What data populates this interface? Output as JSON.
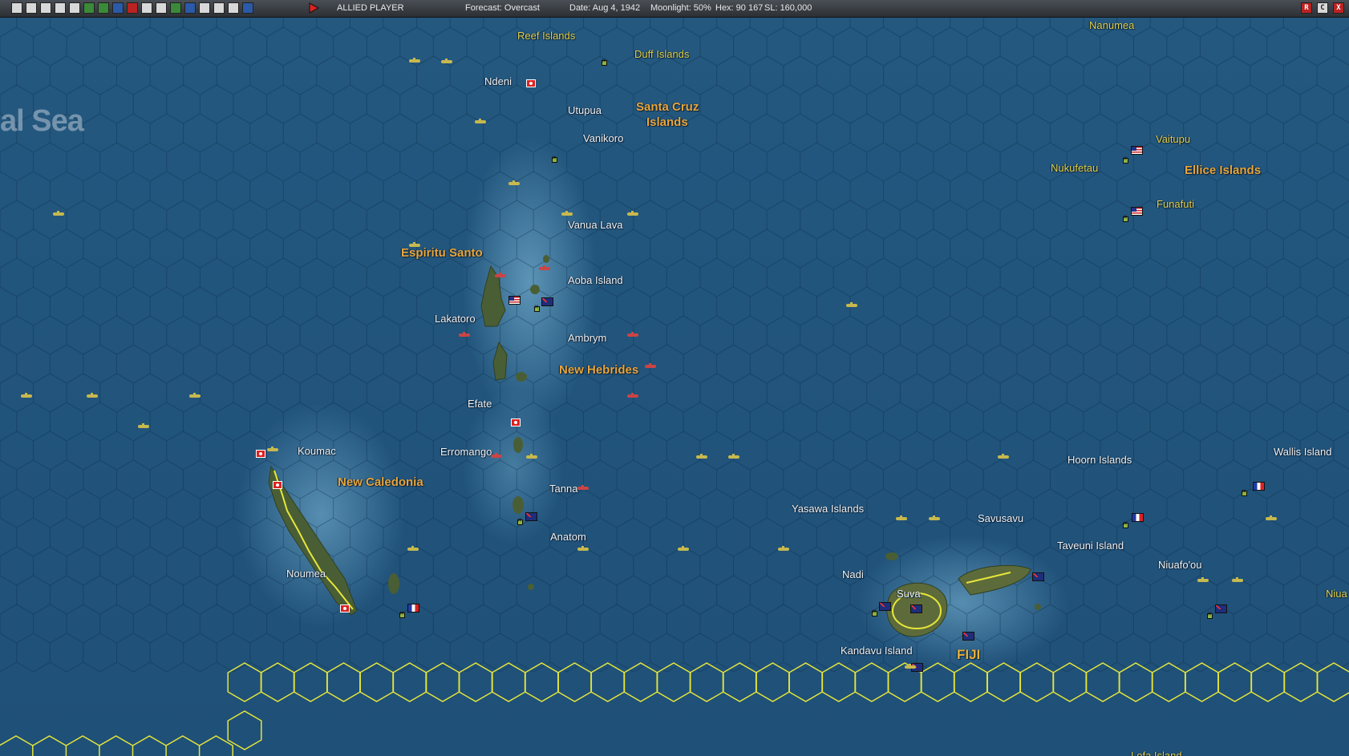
{
  "toolbar": {
    "player": "ALLIED PLAYER",
    "forecast": "Forecast: Overcast",
    "date": "Date: Aug 4, 1942",
    "moonlight": "Moonlight: 50%",
    "hex": "Hex: 90 167",
    "sl": "SL: 160,000",
    "window_buttons": [
      "R",
      "C",
      "X"
    ]
  },
  "map": {
    "sea_label": "al Sea",
    "places": {
      "reef_islands": "Reef Islands",
      "duff_islands": "Duff Islands",
      "nanumea": "Nanumea",
      "ndeni": "Ndeni",
      "utupua": "Utupua",
      "santa_cruz_1": "Santa Cruz",
      "santa_cruz_2": "Islands",
      "vanikoro": "Vanikoro",
      "vaitupu": "Vaitupu",
      "nukufetau": "Nukufetau",
      "ellice_islands": "Ellice Islands",
      "funafuti": "Funafuti",
      "vanua_lava": "Vanua Lava",
      "espiritu_santo": "Espiritu Santo",
      "aoba_island": "Aoba Island",
      "lakatoro": "Lakatoro",
      "ambrym": "Ambrym",
      "new_hebrides": "New Hebrides",
      "efate": "Efate",
      "koumac": "Koumac",
      "erromango": "Erromango",
      "new_caledonia": "New Caledonia",
      "tanna": "Tanna",
      "anatom": "Anatom",
      "noumea": "Noumea",
      "yasawa_islands": "Yasawa Islands",
      "savusavu": "Savusavu",
      "hoorn_islands": "Hoorn Islands",
      "wallis_island": "Wallis Island",
      "taveuni_island": "Taveuni Island",
      "nadi": "Nadi",
      "niuafoou": "Niuafo'ou",
      "suva": "Suva",
      "niua": "Niua",
      "kandavu_island": "Kandavu Island",
      "fiji": "FIJI",
      "lofa_island": "Lofa Island"
    }
  }
}
